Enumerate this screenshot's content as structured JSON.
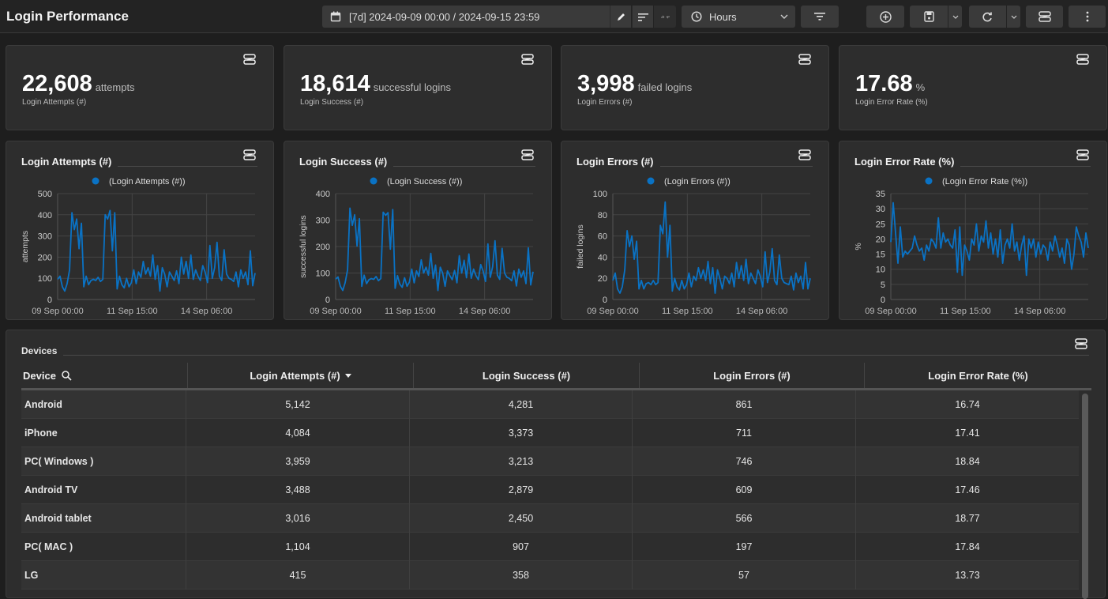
{
  "header": {
    "title": "Login Performance",
    "date_range": "[7d] 2024-09-09 00:00 / 2024-09-15 23:59",
    "granularity": "Hours"
  },
  "toolbar_icons": [
    "calendar-icon",
    "edit-icon",
    "sort-icon",
    "compare-icon",
    "clock-icon",
    "chevron-down-icon",
    "filter-icon",
    "add-circle-icon",
    "save-icon",
    "chevron-down-icon",
    "refresh-icon",
    "chevron-down-icon",
    "widget-icon",
    "more-vertical-icon"
  ],
  "kpis": [
    {
      "value": "22,608",
      "unit": "attempts",
      "label": "Login Attempts (#)"
    },
    {
      "value": "18,614",
      "unit": "successful logins",
      "label": "Login Success (#)"
    },
    {
      "value": "3,998",
      "unit": "failed logins",
      "label": "Login Errors (#)"
    },
    {
      "value": "17.68",
      "unit": "%",
      "label": "Login Error Rate (%)"
    }
  ],
  "colors": {
    "series": "#0a72c4",
    "background": "#1e1e1e",
    "card": "#2d2d2d"
  },
  "chart_data": [
    {
      "type": "line",
      "title": "Login Attempts (#)",
      "legend": "(Login Attempts (#))",
      "ylabel": "attempts",
      "ylim": [
        0,
        500
      ],
      "yticks": [
        "0",
        "100",
        "200",
        "300",
        "400",
        "500"
      ],
      "xticks": [
        "09 Sep 00:00",
        "11 Sep 15:00",
        "14 Sep 06:00"
      ],
      "x_range": [
        "2024-09-09 00:00",
        "2024-09-15 23:00"
      ],
      "interval": "2h",
      "grid": true,
      "legend_position": "top",
      "values": [
        95,
        110,
        60,
        40,
        75,
        140,
        410,
        330,
        380,
        240,
        360,
        60,
        110,
        70,
        90,
        95,
        90,
        105,
        85,
        95,
        400,
        380,
        420,
        230,
        410,
        50,
        110,
        70,
        55,
        100,
        60,
        80,
        140,
        75,
        130,
        105,
        180,
        120,
        150,
        110,
        210,
        95,
        160,
        40,
        150,
        120,
        60,
        130,
        110,
        90,
        135,
        75,
        200,
        120,
        180,
        100,
        210,
        95,
        140,
        110,
        90,
        160,
        130,
        80,
        255,
        100,
        150,
        270,
        110,
        90,
        235,
        120,
        100,
        95,
        85,
        130,
        60,
        140,
        100,
        130,
        70,
        230,
        65,
        125
      ]
    },
    {
      "type": "line",
      "title": "Login Success (#)",
      "legend": "(Login Success (#))",
      "ylabel": "successful logins",
      "ylim": [
        0,
        400
      ],
      "yticks": [
        "0",
        "100",
        "200",
        "300",
        "400"
      ],
      "xticks": [
        "09 Sep 00:00",
        "11 Sep 15:00",
        "14 Sep 06:00"
      ],
      "x_range": [
        "2024-09-09 00:00",
        "2024-09-15 23:00"
      ],
      "interval": "2h",
      "grid": true,
      "legend_position": "top",
      "values": [
        77,
        85,
        50,
        34,
        63,
        112,
        345,
        280,
        320,
        202,
        305,
        50,
        92,
        60,
        75,
        79,
        76,
        87,
        71,
        79,
        330,
        318,
        328,
        190,
        340,
        42,
        90,
        58,
        46,
        82,
        50,
        66,
        115,
        63,
        108,
        87,
        150,
        100,
        122,
        92,
        174,
        80,
        130,
        34,
        122,
        100,
        50,
        108,
        90,
        75,
        110,
        63,
        165,
        100,
        148,
        82,
        172,
        80,
        115,
        90,
        75,
        132,
        108,
        68,
        210,
        84,
        124,
        222,
        92,
        76,
        193,
        100,
        84,
        80,
        71,
        108,
        51,
        115,
        84,
        108,
        60,
        195,
        55,
        105
      ]
    },
    {
      "type": "line",
      "title": "Login Errors (#)",
      "legend": "(Login Errors (#))",
      "ylabel": "failed logins",
      "ylim": [
        0,
        100
      ],
      "yticks": [
        "0",
        "20",
        "40",
        "60",
        "80",
        "100"
      ],
      "xticks": [
        "09 Sep 00:00",
        "11 Sep 15:00",
        "14 Sep 06:00"
      ],
      "x_range": [
        "2024-09-09 00:00",
        "2024-09-15 23:00"
      ],
      "interval": "2h",
      "grid": true,
      "legend_position": "top",
      "values": [
        18,
        25,
        10,
        6,
        12,
        28,
        65,
        50,
        60,
        38,
        55,
        10,
        18,
        10,
        15,
        16,
        14,
        18,
        14,
        16,
        70,
        62,
        92,
        40,
        70,
        8,
        20,
        12,
        9,
        18,
        10,
        14,
        25,
        12,
        22,
        18,
        30,
        20,
        28,
        18,
        36,
        15,
        30,
        6,
        28,
        20,
        10,
        22,
        20,
        15,
        25,
        12,
        35,
        20,
        32,
        18,
        38,
        15,
        25,
        20,
        15,
        28,
        22,
        12,
        45,
        16,
        26,
        48,
        18,
        14,
        42,
        20,
        16,
        15,
        14,
        22,
        9,
        25,
        16,
        22,
        10,
        35,
        10,
        20
      ]
    },
    {
      "type": "line",
      "title": "Login Error Rate (%)",
      "legend": "(Login Error Rate (%))",
      "ylabel": "%",
      "ylim": [
        0,
        35
      ],
      "yticks": [
        "0",
        "5",
        "10",
        "15",
        "20",
        "25",
        "30",
        "35"
      ],
      "xticks": [
        "09 Sep 00:00",
        "11 Sep 15:00",
        "14 Sep 06:00"
      ],
      "x_range": [
        "2024-09-09 00:00",
        "2024-09-15 23:00"
      ],
      "interval": "2h",
      "grid": true,
      "legend_position": "top",
      "values": [
        19,
        32,
        22,
        12,
        24,
        14,
        16,
        15,
        16,
        17,
        21,
        18,
        16,
        17,
        13,
        18,
        16,
        20,
        19,
        17,
        27,
        17,
        22,
        19,
        20,
        18,
        17,
        23,
        9,
        24,
        8,
        18,
        16,
        13,
        20,
        18,
        25,
        16,
        21,
        19,
        26,
        17,
        22,
        15,
        20,
        14,
        23,
        12,
        18,
        20,
        17,
        25,
        16,
        19,
        13,
        18,
        21,
        8,
        20,
        17,
        20,
        14,
        19,
        15,
        18,
        17,
        13,
        19,
        16,
        21,
        18,
        14,
        17,
        12,
        20,
        18,
        10,
        15,
        24,
        21,
        19,
        14,
        22,
        17
      ]
    }
  ],
  "devices": {
    "title": "Devices",
    "columns": [
      "Device",
      "Login Attempts (#)",
      "Login Success (#)",
      "Login Errors (#)",
      "Login Error Rate (%)"
    ],
    "sort_column": "Login Attempts (#)",
    "sort_direction": "descending",
    "rows": [
      [
        "Android",
        "5,142",
        "4,281",
        "861",
        "16.74"
      ],
      [
        "iPhone",
        "4,084",
        "3,373",
        "711",
        "17.41"
      ],
      [
        "PC( Windows )",
        "3,959",
        "3,213",
        "746",
        "18.84"
      ],
      [
        "Android TV",
        "3,488",
        "2,879",
        "609",
        "17.46"
      ],
      [
        "Android tablet",
        "3,016",
        "2,450",
        "566",
        "18.77"
      ],
      [
        "PC( MAC )",
        "1,104",
        "907",
        "197",
        "17.84"
      ],
      [
        "LG",
        "415",
        "358",
        "57",
        "13.73"
      ]
    ]
  }
}
